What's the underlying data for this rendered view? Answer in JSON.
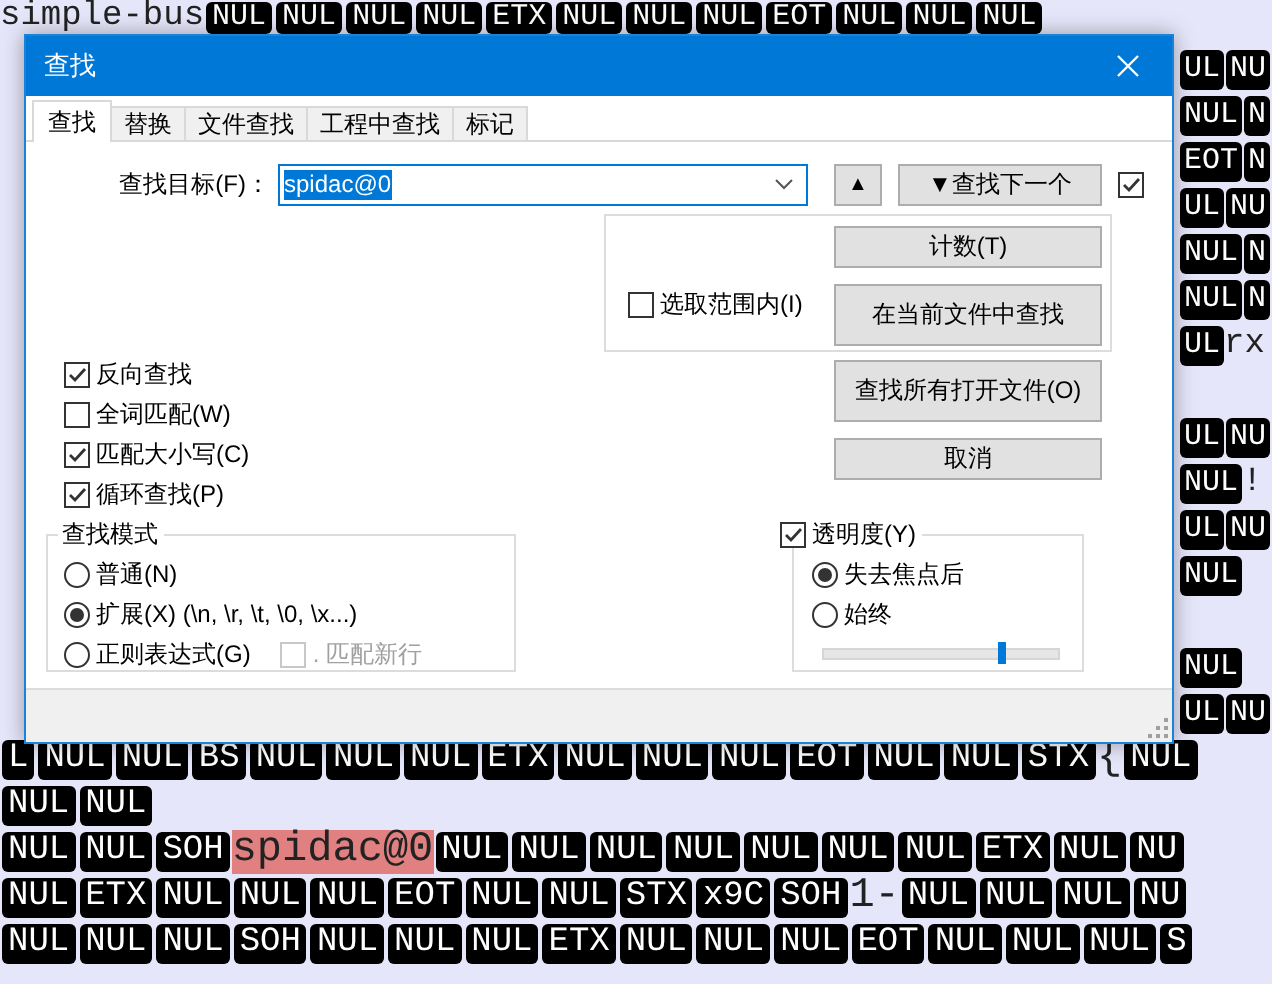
{
  "editor": {
    "top_line": [
      {
        "text": "simple-bus",
        "kind": "text"
      },
      {
        "text": "NUL",
        "kind": "ctrl"
      },
      {
        "text": "NUL",
        "kind": "ctrl"
      },
      {
        "text": "NUL",
        "kind": "ctrl"
      },
      {
        "text": "NUL",
        "kind": "ctrl"
      },
      {
        "text": "ETX",
        "kind": "ctrl"
      },
      {
        "text": "NUL",
        "kind": "ctrl"
      },
      {
        "text": "NUL",
        "kind": "ctrl"
      },
      {
        "text": "NUL",
        "kind": "ctrl"
      },
      {
        "text": "EOT",
        "kind": "ctrl"
      },
      {
        "text": "NUL",
        "kind": "ctrl"
      },
      {
        "text": "NUL",
        "kind": "ctrl"
      },
      {
        "text": "NUL",
        "kind": "ctrl"
      }
    ],
    "right_edge_blocks": [
      [
        [
          {
            "text": "UL",
            "kind": "ctrl"
          },
          {
            "text": "NU",
            "kind": "ctrl"
          }
        ],
        [
          {
            "text": "NUL",
            "kind": "ctrl"
          },
          {
            "text": "N",
            "kind": "ctrl"
          }
        ],
        [
          {
            "text": "EOT",
            "kind": "ctrl"
          },
          {
            "text": "N",
            "kind": "ctrl"
          }
        ],
        [
          {
            "text": "UL",
            "kind": "ctrl"
          },
          {
            "text": "NU",
            "kind": "ctrl"
          }
        ],
        [
          {
            "text": "NUL",
            "kind": "ctrl"
          },
          {
            "text": "N",
            "kind": "ctrl"
          }
        ],
        [
          {
            "text": "NUL",
            "kind": "ctrl"
          },
          {
            "text": "N",
            "kind": "ctrl"
          }
        ],
        [
          {
            "text": "UL",
            "kind": "ctrl"
          },
          {
            "text": "rx",
            "kind": "text"
          }
        ]
      ],
      [
        [
          {
            "text": "UL",
            "kind": "ctrl"
          },
          {
            "text": "NU",
            "kind": "ctrl"
          }
        ],
        [
          {
            "text": "NUL",
            "kind": "ctrl"
          },
          {
            "text": "!",
            "kind": "text"
          }
        ],
        [
          {
            "text": "UL",
            "kind": "ctrl"
          },
          {
            "text": "NU",
            "kind": "ctrl"
          }
        ],
        [
          {
            "text": "NUL",
            "kind": "ctrl"
          }
        ]
      ],
      [
        [
          {
            "text": "NUL",
            "kind": "ctrl"
          }
        ],
        [
          {
            "text": "UL",
            "kind": "ctrl"
          },
          {
            "text": "NU",
            "kind": "ctrl"
          }
        ]
      ]
    ],
    "bottom_lines": [
      [
        {
          "text": "L",
          "kind": "ctrl"
        },
        {
          "text": "NUL",
          "kind": "ctrl"
        },
        {
          "text": "NUL",
          "kind": "ctrl"
        },
        {
          "text": "BS",
          "kind": "ctrl"
        },
        {
          "text": "NUL",
          "kind": "ctrl"
        },
        {
          "text": "NUL",
          "kind": "ctrl"
        },
        {
          "text": "NUL",
          "kind": "ctrl"
        },
        {
          "text": "ETX",
          "kind": "ctrl"
        },
        {
          "text": "NUL",
          "kind": "ctrl"
        },
        {
          "text": "NUL",
          "kind": "ctrl"
        },
        {
          "text": "NUL",
          "kind": "ctrl"
        },
        {
          "text": "EOT",
          "kind": "ctrl"
        },
        {
          "text": "NUL",
          "kind": "ctrl"
        },
        {
          "text": "NUL",
          "kind": "ctrl"
        },
        {
          "text": "STX",
          "kind": "ctrl"
        },
        {
          "text": "{",
          "kind": "text"
        },
        {
          "text": "NUL",
          "kind": "ctrl"
        }
      ],
      [
        {
          "text": "NUL",
          "kind": "ctrl"
        },
        {
          "text": "NUL",
          "kind": "ctrl"
        }
      ],
      [
        {
          "text": "NUL",
          "kind": "ctrl"
        },
        {
          "text": "NUL",
          "kind": "ctrl"
        },
        {
          "text": "SOH",
          "kind": "ctrl"
        },
        {
          "text": "spidac@0",
          "kind": "match"
        },
        {
          "text": "NUL",
          "kind": "ctrl"
        },
        {
          "text": "NUL",
          "kind": "ctrl"
        },
        {
          "text": "NUL",
          "kind": "ctrl"
        },
        {
          "text": "NUL",
          "kind": "ctrl"
        },
        {
          "text": "NUL",
          "kind": "ctrl"
        },
        {
          "text": "NUL",
          "kind": "ctrl"
        },
        {
          "text": "NUL",
          "kind": "ctrl"
        },
        {
          "text": "ETX",
          "kind": "ctrl"
        },
        {
          "text": "NUL",
          "kind": "ctrl"
        },
        {
          "text": "NU",
          "kind": "ctrl"
        }
      ],
      [
        {
          "text": "NUL",
          "kind": "ctrl"
        },
        {
          "text": "ETX",
          "kind": "ctrl"
        },
        {
          "text": "NUL",
          "kind": "ctrl"
        },
        {
          "text": "NUL",
          "kind": "ctrl"
        },
        {
          "text": "NUL",
          "kind": "ctrl"
        },
        {
          "text": "EOT",
          "kind": "ctrl"
        },
        {
          "text": "NUL",
          "kind": "ctrl"
        },
        {
          "text": "NUL",
          "kind": "ctrl"
        },
        {
          "text": "STX",
          "kind": "ctrl"
        },
        {
          "text": "x9C",
          "kind": "ctrl"
        },
        {
          "text": "SOH",
          "kind": "ctrl"
        },
        {
          "text": "1-",
          "kind": "text"
        },
        {
          "text": "NUL",
          "kind": "ctrl"
        },
        {
          "text": "NUL",
          "kind": "ctrl"
        },
        {
          "text": "NUL",
          "kind": "ctrl"
        },
        {
          "text": "NU",
          "kind": "ctrl"
        }
      ],
      [
        {
          "text": "NUL",
          "kind": "ctrl"
        },
        {
          "text": "NUL",
          "kind": "ctrl"
        },
        {
          "text": "NUL",
          "kind": "ctrl"
        },
        {
          "text": "SOH",
          "kind": "ctrl"
        },
        {
          "text": "NUL",
          "kind": "ctrl"
        },
        {
          "text": "NUL",
          "kind": "ctrl"
        },
        {
          "text": "NUL",
          "kind": "ctrl"
        },
        {
          "text": "ETX",
          "kind": "ctrl"
        },
        {
          "text": "NUL",
          "kind": "ctrl"
        },
        {
          "text": "NUL",
          "kind": "ctrl"
        },
        {
          "text": "NUL",
          "kind": "ctrl"
        },
        {
          "text": "EOT",
          "kind": "ctrl"
        },
        {
          "text": "NUL",
          "kind": "ctrl"
        },
        {
          "text": "NUL",
          "kind": "ctrl"
        },
        {
          "text": "NUL",
          "kind": "ctrl"
        },
        {
          "text": "S",
          "kind": "ctrl"
        }
      ]
    ]
  },
  "dialog": {
    "title": "查找",
    "tabs": [
      {
        "label": "查找",
        "selected": true
      },
      {
        "label": "替换",
        "selected": false
      },
      {
        "label": "文件查找",
        "selected": false
      },
      {
        "label": "工程中查找",
        "selected": false
      },
      {
        "label": "标记",
        "selected": false
      }
    ],
    "find_what": {
      "label": "查找目标(F)：",
      "value": "spidac@0"
    },
    "find_previous": "▲",
    "find_next": "▼查找下一个",
    "stay_open": {
      "checked": true
    },
    "in_selection": {
      "label": "选取范围内(I)",
      "checked": false
    },
    "selection_buttons": [
      "计数(T)",
      "在当前文件中查找"
    ],
    "other_buttons": [
      "查找所有打开文件(O)",
      "取消"
    ],
    "options": [
      {
        "label": "反向查找",
        "checked": true
      },
      {
        "label": "全词匹配(W)",
        "checked": false
      },
      {
        "label": "匹配大小写(C)",
        "checked": true
      },
      {
        "label": "循环查找(P)",
        "checked": true
      }
    ],
    "search_mode": {
      "title": "查找模式",
      "modes": [
        {
          "label": "普通(N)",
          "selected": false
        },
        {
          "label": "扩展(X) (\\n, \\r, \\t, \\0, \\x...)",
          "selected": true
        },
        {
          "label": "正则表达式(G)",
          "selected": false
        }
      ],
      "dot_newline": {
        "label": ". 匹配新行",
        "checked": false,
        "disabled": true
      }
    },
    "transparency": {
      "label": "透明度(Y)",
      "checked": true,
      "modes": [
        {
          "label": "失去焦点后",
          "selected": true
        },
        {
          "label": "始终",
          "selected": false
        }
      ],
      "level": 0.76
    }
  }
}
